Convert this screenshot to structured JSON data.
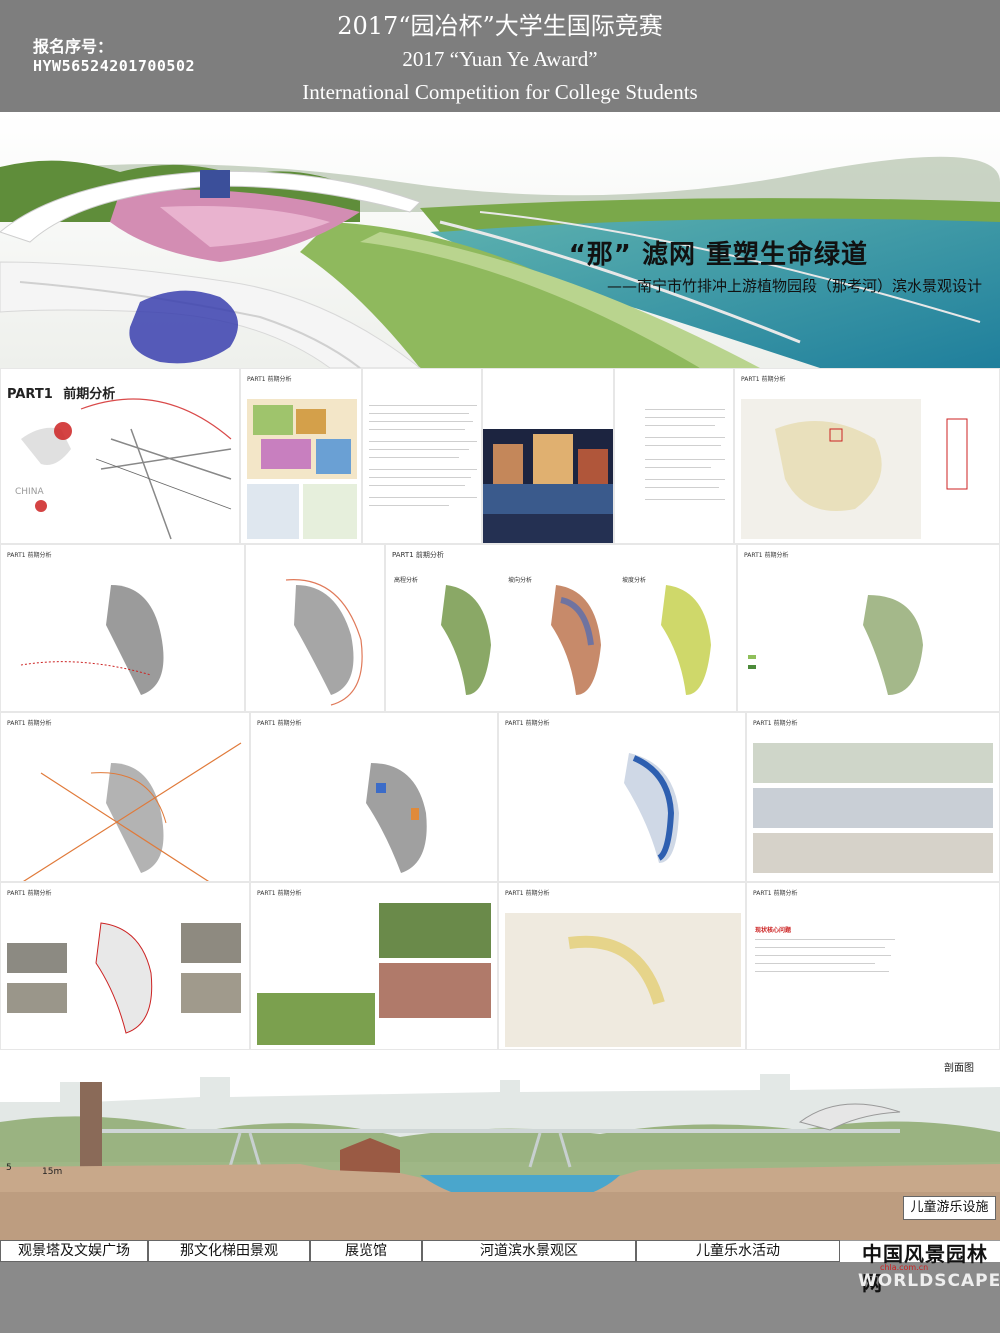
{
  "header": {
    "title_zh": "2017“园冶杯”大学生国际竞赛",
    "title_en_line1": "2017 “Yuan Ye Award”",
    "title_en_line2": "International Competition for College Students",
    "registration_label": "报名序号：",
    "registration_number": "HYW56524201700502"
  },
  "hero": {
    "title": "“那” 滤网  重塑生命绿道",
    "subtitle": "——南宁市竹排冲上游植物园段（那考河）滨水景观设计"
  },
  "boards": {
    "part1_label": "PART1",
    "part1_title": "前期分析",
    "part1_short": "PART1 前期分析",
    "china_label": "CHINA",
    "height_analysis": "高程分析",
    "slope_analysis": "坡向分析",
    "gradient_analysis": "坡度分析",
    "core_problem": "现状核心问题"
  },
  "section": {
    "label": "剖面图",
    "scale_0": "5",
    "scale_1": "15m",
    "zones": [
      "观景塔及文娱广场",
      "那文化梯田景观",
      "展览馆",
      "河道滨水景观区",
      "儿童乐水活动"
    ],
    "extra_zone": "儿童游乐设施"
  },
  "footer": {
    "logo_zh": "中国风景园林网",
    "logo_url": "chla.com.cn",
    "logo_en": "WORLDSCAPE"
  },
  "colors": {
    "header_bg": "#7e7e7e",
    "accent_red": "#cc2222",
    "water_blue": "#2e7fb6"
  }
}
